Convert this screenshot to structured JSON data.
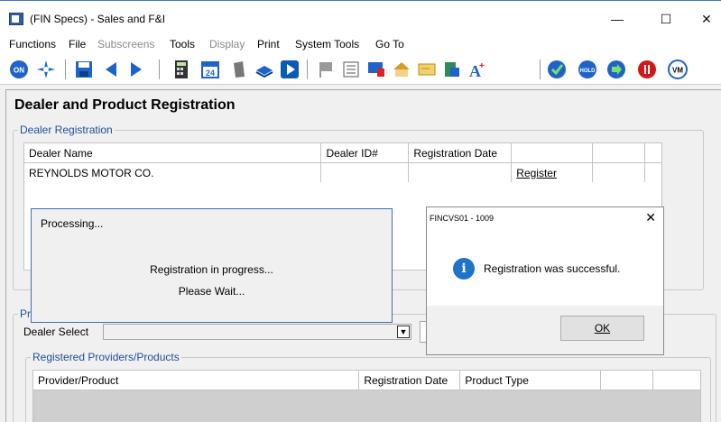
{
  "window": {
    "title": "(FIN Specs) - Sales and F&I",
    "minimize": "—",
    "maximize": "☐",
    "close": "✕"
  },
  "menu": [
    {
      "label": "Functions",
      "enabled": true
    },
    {
      "label": "File",
      "enabled": true
    },
    {
      "label": "Subscreens",
      "enabled": false
    },
    {
      "label": "Tools",
      "enabled": true
    },
    {
      "label": "Display",
      "enabled": false
    },
    {
      "label": "Print",
      "enabled": true
    },
    {
      "label": "System Tools",
      "enabled": true
    },
    {
      "label": "Go To",
      "enabled": true
    }
  ],
  "toolbar": {
    "on_label": "ON",
    "hold_label": "HOLD",
    "vm_label": "VM",
    "calendar_label": "24"
  },
  "page": {
    "title": "Dealer and Product Registration"
  },
  "dealer_registration": {
    "legend": "Dealer Registration",
    "headers": [
      "Dealer Name",
      "Dealer ID#",
      "Registration Date",
      "",
      "",
      ""
    ],
    "rows": [
      {
        "name": "REYNOLDS MOTOR CO.",
        "id": "",
        "date": "",
        "action": "Register"
      }
    ]
  },
  "provider_section": {
    "legend": "Pro",
    "dealer_select_label": "Dealer Select",
    "dealer_select_value": ""
  },
  "registered_products": {
    "legend": "Registered Providers/Products",
    "headers": [
      "Provider/Product",
      "Registration Date",
      "Product Type",
      "",
      ""
    ]
  },
  "processing_dialog": {
    "title": "Processing...",
    "line1": "Registration in progress...",
    "line2": "Please Wait..."
  },
  "message_box": {
    "title": "FINCVS01 - 1009",
    "close": "✕",
    "icon": "i",
    "message": "Registration was successful.",
    "ok_label": "OK"
  },
  "colors": {
    "legend_blue": "#1f4e96",
    "dialog_border": "#3e6fb0",
    "info_icon": "#1e74c8"
  }
}
